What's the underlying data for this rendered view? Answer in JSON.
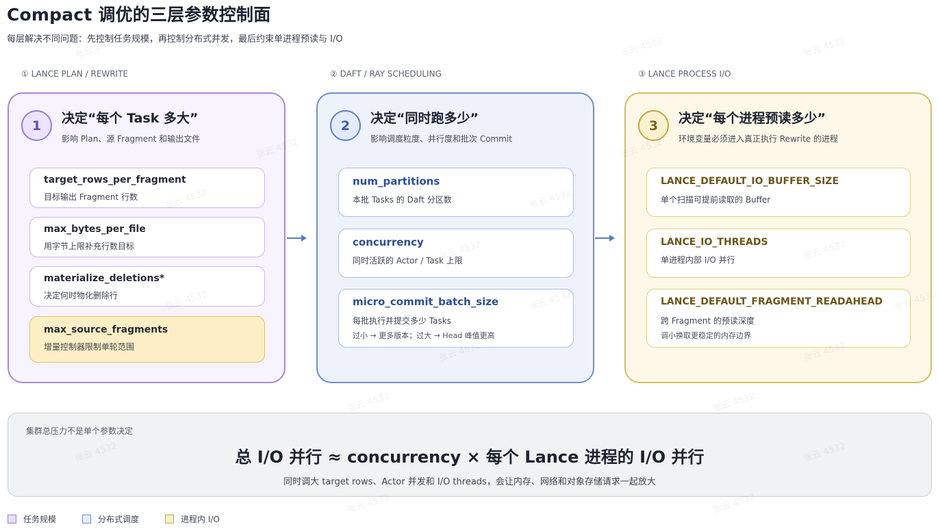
{
  "header": {
    "title": "Compact 调优的三层参数控制面",
    "subtitle": "每层解决不同问题：先控制任务规模，再控制分布式并发，最后约束单进程预读与 I/O"
  },
  "columns": [
    {
      "label": "① LANCE PLAN / REWRITE",
      "badge": "1",
      "heading": "决定“每个 Task 多大”",
      "subheading": "影响 Plan、源 Fragment 和输出文件",
      "cards": [
        {
          "name": "target_rows_per_fragment",
          "desc": "目标输出 Fragment 行数"
        },
        {
          "name": "max_bytes_per_file",
          "desc": "用字节上限补充行数目标"
        },
        {
          "name": "materialize_deletions*",
          "desc": "决定何时物化删除行"
        },
        {
          "name": "max_source_fragments",
          "desc": "增量控制器限制单轮范围"
        }
      ]
    },
    {
      "label": "② DAFT / RAY SCHEDULING",
      "badge": "2",
      "heading": "决定“同时跑多少”",
      "subheading": "影响调度粒度、并行度和批次 Commit",
      "cards": [
        {
          "name": "num_partitions",
          "desc": "本批 Tasks 的 Daft 分区数"
        },
        {
          "name": "concurrency",
          "desc": "同时活跃的 Actor / Task 上限"
        },
        {
          "name": "micro_commit_batch_size",
          "desc": "每批执行并提交多少 Tasks",
          "note": "过小 → 更多版本；过大 → Head 峰值更高"
        }
      ]
    },
    {
      "label": "③ LANCE PROCESS I/O",
      "badge": "3",
      "heading": "决定“每个进程预读多少”",
      "subheading": "环境变量必须进入真正执行 Rewrite 的进程",
      "cards": [
        {
          "name": "LANCE_DEFAULT_IO_BUFFER_SIZE",
          "desc": "单个扫描可提前读取的 Buffer"
        },
        {
          "name": "LANCE_IO_THREADS",
          "desc": "单进程内部 I/O 并行"
        },
        {
          "name": "LANCE_DEFAULT_FRAGMENT_READAHEAD",
          "desc": "跨 Fragment 的预读深度",
          "note": "调小换取更稳定的内存边界"
        }
      ]
    }
  ],
  "summary": {
    "label": "集群总压力不是单个参数决定",
    "formula": "总 I/O 并行 ≈ concurrency × 每个 Lance 进程的 I/O 并行",
    "note": "同时调大 target rows、Actor 并发和 I/O threads，会让内存、网络和对象存储请求一起放大"
  },
  "legend": [
    {
      "label": "任务规模",
      "color": "#e9ddff",
      "border": "#9b7fd1"
    },
    {
      "label": "分布式调度",
      "color": "#e6eefb",
      "border": "#6f8fd0"
    },
    {
      "label": "进程内 I/O",
      "color": "#fbefc6",
      "border": "#c9a845"
    }
  ],
  "watermark": "张云 4532",
  "colors": {
    "purple_accent": "#a68ad6",
    "blue_accent": "#6f8fd0",
    "gold_accent": "#d8bd5f",
    "arrow": "#5b7cc4"
  }
}
